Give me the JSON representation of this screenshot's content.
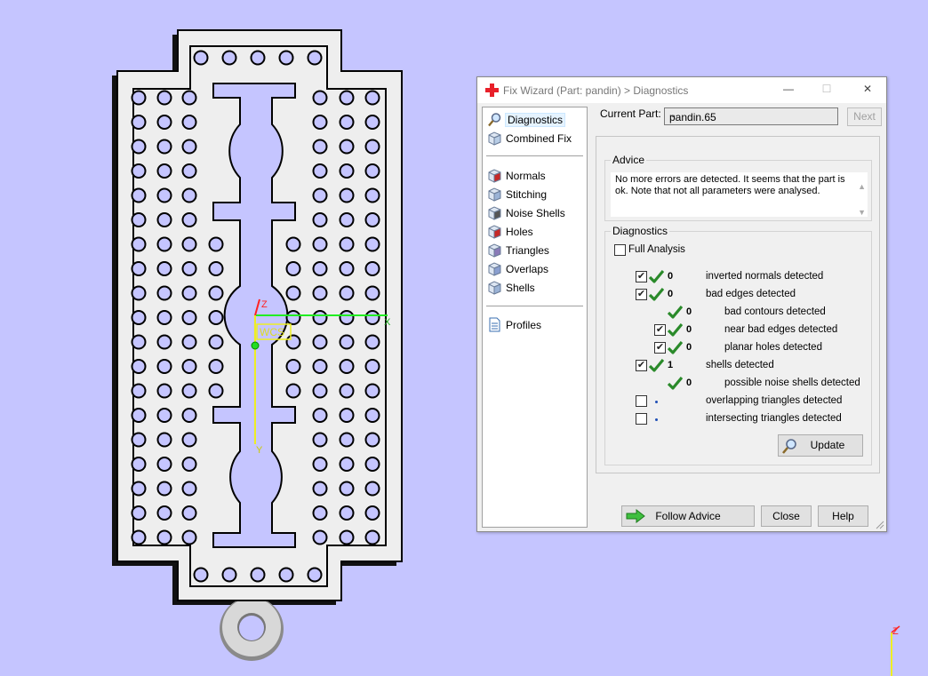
{
  "viewport": {
    "axis_z": "Z",
    "axis_x": "X",
    "axis_y": "Y",
    "wcs_label": "WCS",
    "corner_axis_z": "Z",
    "background_color": "#c5c5ff",
    "part_fill_color": "#eeeeee",
    "axis_x_color": "#22ee22",
    "axis_y_color": "#eeee22",
    "axis_z_color": "#ff2222"
  },
  "dialog": {
    "title": "Fix Wizard (Part: pandin) > Diagnostics",
    "nav_top": [
      {
        "label": "Diagnostics",
        "icon": "magnifier-icon",
        "selected": true
      },
      {
        "label": "Combined Fix",
        "icon": "cube-icon"
      }
    ],
    "nav_tools": [
      {
        "label": "Normals",
        "icon": "normals-cube-icon"
      },
      {
        "label": "Stitching",
        "icon": "stitching-cube-icon"
      },
      {
        "label": "Noise Shells",
        "icon": "noise-shells-cube-icon"
      },
      {
        "label": "Holes",
        "icon": "holes-cube-icon"
      },
      {
        "label": "Triangles",
        "icon": "triangles-cube-icon"
      },
      {
        "label": "Overlaps",
        "icon": "overlaps-cube-icon"
      },
      {
        "label": "Shells",
        "icon": "shells-cube-icon"
      }
    ],
    "nav_bottom": [
      {
        "label": "Profiles",
        "icon": "profiles-document-icon"
      }
    ],
    "current_part_label": "Current Part:",
    "current_part_value": "pandin.65",
    "next_button": "Next",
    "advice_title": "Advice",
    "advice_text": "No more errors are detected. It seems that the part is ok. Note that not all parameters were analysed.",
    "diagnostics_title": "Diagnostics",
    "full_analysis_label": "Full Analysis",
    "full_analysis_checked": false,
    "rows": [
      {
        "checkbox": true,
        "checked": true,
        "status": "ok",
        "count": "0",
        "label": "inverted normals detected",
        "indent": 0
      },
      {
        "checkbox": true,
        "checked": true,
        "status": "ok",
        "count": "0",
        "label": "bad edges detected",
        "indent": 0
      },
      {
        "checkbox": false,
        "checked": false,
        "status": "ok",
        "count": "0",
        "label": "bad contours detected",
        "indent": 1
      },
      {
        "checkbox": true,
        "checked": true,
        "status": "ok",
        "count": "0",
        "label": "near bad edges detected",
        "indent": 1
      },
      {
        "checkbox": true,
        "checked": true,
        "status": "ok",
        "count": "0",
        "label": "planar holes detected",
        "indent": 1
      },
      {
        "checkbox": true,
        "checked": true,
        "status": "ok",
        "count": "1",
        "label": "shells detected",
        "indent": 0
      },
      {
        "checkbox": false,
        "checked": false,
        "status": "ok",
        "count": "0",
        "label": "possible noise shells detected",
        "indent": 1
      },
      {
        "checkbox": true,
        "checked": false,
        "status": "pending",
        "count": "",
        "label": "overlapping triangles detected",
        "indent": 0
      },
      {
        "checkbox": true,
        "checked": false,
        "status": "pending",
        "count": "",
        "label": "intersecting triangles detected",
        "indent": 0
      }
    ],
    "update_button": "Update",
    "follow_advice_button": "Follow Advice",
    "close_button": "Close",
    "help_button": "Help",
    "ok_color": "#2a8a2a"
  }
}
